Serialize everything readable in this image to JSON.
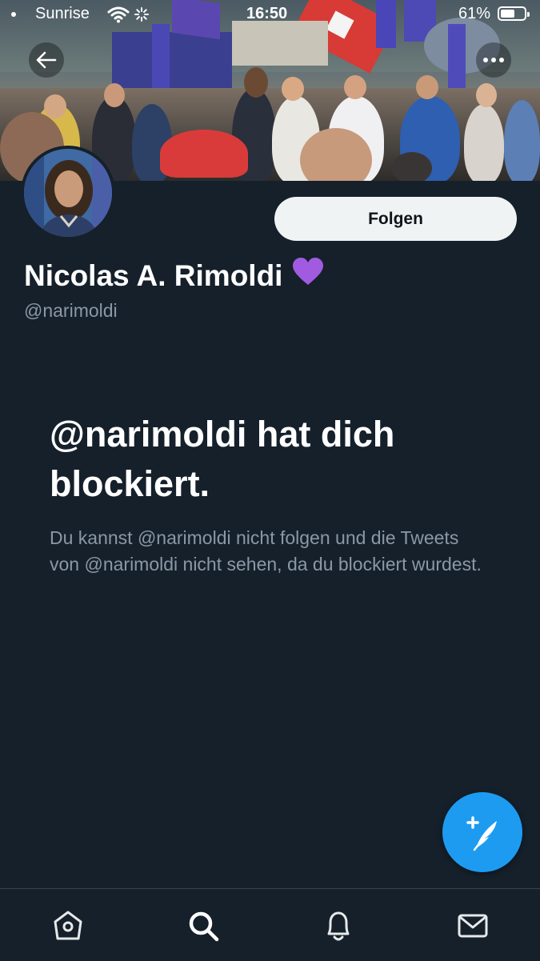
{
  "status_bar": {
    "carrier": "Sunrise",
    "time": "16:50",
    "battery_percent": "61%",
    "battery_level": 0.61
  },
  "header": {
    "back_icon": "arrow-left-icon",
    "more_icon": "more-horizontal-icon",
    "banner_description_colors": [
      "#4b5a63",
      "#7c6f64",
      "#5548a8",
      "#d93b3b"
    ]
  },
  "profile": {
    "display_name": "Nicolas A. Rimoldi",
    "badge_emoji": "💜",
    "handle": "@narimoldi",
    "follow_label": "Folgen"
  },
  "blocked": {
    "title": "@narimoldi hat dich blockiert.",
    "message": "Du kannst @narimoldi nicht folgen und die Tweets von @narimoldi nicht sehen, da du blockiert wurdest."
  },
  "fab": {
    "icon": "compose-tweet-icon"
  },
  "nav": {
    "items": [
      {
        "icon": "home-icon"
      },
      {
        "icon": "search-icon"
      },
      {
        "icon": "notifications-bell-icon"
      },
      {
        "icon": "messages-envelope-icon"
      }
    ]
  },
  "colors": {
    "background": "#15202b",
    "accent": "#1d9bf0",
    "secondary_text": "#8b98a5",
    "follow_button_bg": "#eff3f4"
  }
}
